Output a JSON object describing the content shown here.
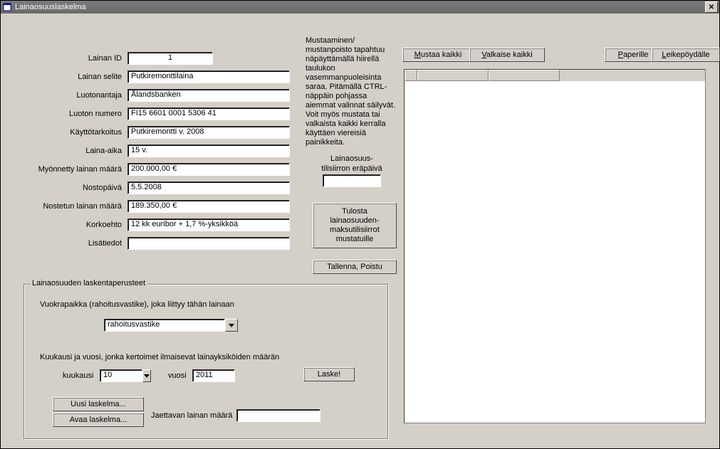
{
  "window": {
    "title": "Lainaosuuslaskelma"
  },
  "fields": {
    "lainan_id": {
      "label": "Lainan ID",
      "value": "1"
    },
    "lainan_selite": {
      "label": "Lainan selite",
      "value": "Putkiremonttilaina"
    },
    "luotonantaja": {
      "label": "Luotonantaja",
      "value": "Ålandsbanken"
    },
    "luoton_numero": {
      "label": "Luoton numero",
      "value": "FI15 6601 0001 5306 41"
    },
    "kayttotarkoitus": {
      "label": "Käyttötarkoitus",
      "value": "Putkiremontti v. 2008"
    },
    "laina_aika": {
      "label": "Laina-aika",
      "value": "15 v."
    },
    "myonnetty": {
      "label": "Myönnetty lainan määrä",
      "value": "200.000,00 €"
    },
    "nostopaiva": {
      "label": "Nostopäivä",
      "value": "5.5.2008"
    },
    "nostetun": {
      "label": "Nostetun lainan määrä",
      "value": "189.350,00 €"
    },
    "korkoehto": {
      "label": "Korkoehto",
      "value": "12 kk euribor + 1,7 %-yksikköä"
    },
    "lisatiedot": {
      "label": "Lisätiedot",
      "value": ""
    }
  },
  "info_text": "Mustaaminen/ mustanpoisto tapahtuu näpäyttämällä hiirellä taulukon vasemmanpuoleisinta saraa. Pitämällä CTRL-näppäin pohjassa aiemmat valinnat säilyvät. Voit myös mustata tai valkaista kaikki kerralla käyttäen viereisiä painikkeita.",
  "mid_col": {
    "erapaiva_label1": "Lainaosuus-",
    "erapaiva_label2": "tilisiirron eräpäivä",
    "erapaiva_value": "",
    "tulosta_btn": "Tulosta lainaosuuden-maksutilisiirrot mustatuille",
    "tallenna_btn": "Tallenna, Poistu"
  },
  "top_buttons": {
    "mustaa": "Mustaa kaikki",
    "valkaise": "Valkaise kaikki",
    "paperille": "Paperille",
    "leike": "Leikepöydälle"
  },
  "group": {
    "legend": "Lainaosuuden laskentaperusteet",
    "vuokra_label": "Vuokrapaikka (rahoitusvastike), joka liittyy tähän lainaan",
    "vuokra_value": "rahoitusvastike",
    "kk_label": "Kuukausi ja vuosi, jonka kertoimet ilmaisevat lainayksiköiden määrän",
    "kuukausi_lbl": "kuukausi",
    "kuukausi_val": "10",
    "vuosi_lbl": "vuosi",
    "vuosi_val": "2011",
    "laske_btn": "Laske!",
    "uusi_btn": "Uusi laskelma...",
    "avaa_btn": "Avaa laskelma...",
    "jaettavan_lbl": "Jaettavan lainan määrä",
    "jaettavan_val": ""
  }
}
